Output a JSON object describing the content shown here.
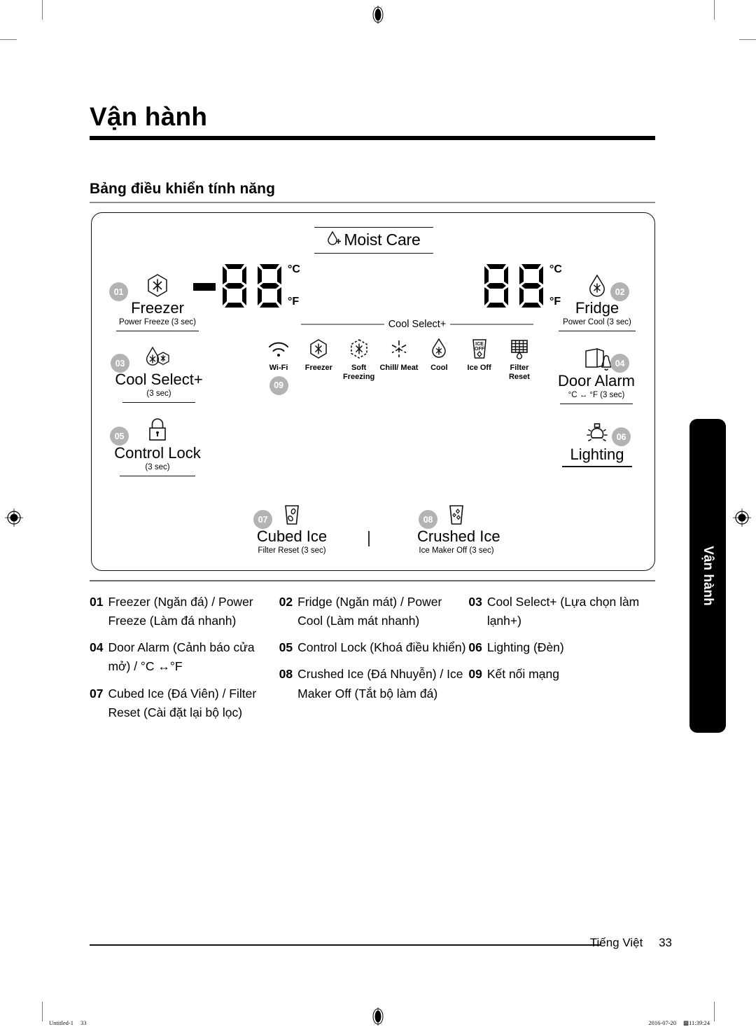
{
  "page": {
    "title": "Vận hành",
    "subtitle": "Bảng điều khiển tính năng",
    "side_tab": "Vận hành",
    "footer_language": "Tiếng Việt",
    "footer_page": "33",
    "slug_left": "Untitled-1",
    "slug_left_page": "33",
    "slug_right_date": "2016-07-20",
    "slug_right_time": "11:39:24",
    "slug_right_mark": "▩"
  },
  "panel": {
    "moist_care": "Moist Care",
    "displays": {
      "freezer": {
        "minus": true,
        "digits": "88",
        "unit_c": "°C",
        "unit_f": "°F"
      },
      "fridge": {
        "minus": false,
        "digits": "88",
        "unit_c": "°C",
        "unit_f": "°F"
      }
    },
    "buttons": [
      {
        "badge": "01",
        "name": "Freezer",
        "sub": "Power Freeze (3 sec)",
        "icon": "snowflake-hexagon-icon"
      },
      {
        "badge": "02",
        "name": "Fridge",
        "sub": "Power Cool (3 sec)",
        "icon": "droplet-snowflake-icon"
      },
      {
        "badge": "03",
        "name": "Cool Select+",
        "sub": "(3 sec)",
        "icon": "cool-select-plus-icon"
      },
      {
        "badge": "04",
        "name": "Door Alarm",
        "sub": "°C ↔ °F (3 sec)",
        "icon": "door-bell-icon"
      },
      {
        "badge": "05",
        "name": "Control Lock",
        "sub": "(3 sec)",
        "icon": "padlock-icon"
      },
      {
        "badge": "06",
        "name": "Lighting",
        "sub": "",
        "icon": "lightbulb-icon"
      },
      {
        "badge": "07",
        "name": "Cubed Ice",
        "sub": "Filter Reset (3 sec)",
        "icon": "cubed-ice-glass-icon"
      },
      {
        "badge": "08",
        "name": "Crushed Ice",
        "sub": "Ice Maker Off (3 sec)",
        "icon": "crushed-ice-glass-icon"
      }
    ],
    "cool_select_strip_label": "Cool Select+",
    "cool_select_items": [
      {
        "name": "Wi-Fi",
        "badge": "09",
        "icon": "wifi-icon"
      },
      {
        "name": "Freezer",
        "badge": "",
        "icon": "snowflake-hexagon-icon"
      },
      {
        "name": "Soft Freezing",
        "badge": "",
        "icon": "snowflake-dashed-hexagon-icon"
      },
      {
        "name": "Chill/ Meat",
        "badge": "",
        "icon": "chill-meat-star-icon"
      },
      {
        "name": "Cool",
        "badge": "",
        "icon": "droplet-snowflake-icon"
      },
      {
        "name": "Ice Off",
        "badge": "",
        "icon": "ice-off-glass-icon"
      },
      {
        "name": "Filter Reset",
        "badge": "",
        "icon": "filter-reset-icon"
      }
    ]
  },
  "legend": {
    "columns": [
      [
        {
          "num": "01",
          "text": "Freezer (Ngăn đá) / Power Freeze (Làm đá nhanh)"
        },
        {
          "num": "04",
          "text": "Door Alarm (Cảnh báo cửa mở) / °C ↔°F"
        },
        {
          "num": "07",
          "text": "Cubed Ice (Đá Viên) / Filter Reset (Cài đặt lại bộ lọc)"
        }
      ],
      [
        {
          "num": "02",
          "text": "Fridge (Ngăn mát) / Power Cool (Làm mát nhanh)"
        },
        {
          "num": "05",
          "text": "Control Lock (Khoá điều khiển)"
        },
        {
          "num": "08",
          "text": "Crushed Ice (Đá Nhuyễn) / Ice Maker Off (Tắt bộ làm đá)"
        }
      ],
      [
        {
          "num": "03",
          "text": "Cool Select+ (Lựa chọn làm lạnh+)"
        },
        {
          "num": "06",
          "text": "Lighting (Đèn)"
        },
        {
          "num": "09",
          "text": "Kết nối mạng"
        }
      ]
    ]
  },
  "colors": {
    "badge_gray": "#b3b3b3",
    "rule_gray": "#8d8d8d",
    "ink": "#111111"
  }
}
